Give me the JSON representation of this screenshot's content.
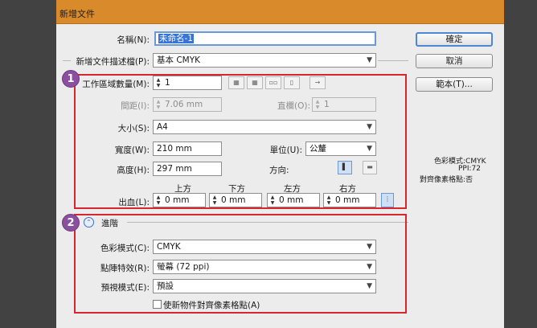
{
  "window": {
    "title": "新增文件"
  },
  "buttons": {
    "ok": "確定",
    "cancel": "取消",
    "templates": "範本(T)..."
  },
  "name": {
    "label": "名稱(N):",
    "value": "未命名-1"
  },
  "profile": {
    "label": "新增文件描述檔(P):",
    "value": "基本 CMYK"
  },
  "artboards": {
    "count_label": "工作區域數量(M):",
    "count": "1",
    "spacing_label": "間距(I):",
    "spacing": "7.06 mm",
    "columns_label": "直欄(O):",
    "columns": "1"
  },
  "size": {
    "label": "大小(S):",
    "value": "A4"
  },
  "width": {
    "label": "寬度(W):",
    "value": "210 mm"
  },
  "height": {
    "label": "高度(H):",
    "value": "297 mm"
  },
  "units": {
    "label": "單位(U):",
    "value": "公釐"
  },
  "orientation": {
    "label": "方向:"
  },
  "bleed": {
    "label": "出血(L):",
    "headers": [
      "上方",
      "下方",
      "左方",
      "右方"
    ],
    "values": [
      "0 mm",
      "0 mm",
      "0 mm",
      "0 mm"
    ]
  },
  "advanced": {
    "title": "進階",
    "color_mode_label": "色彩模式(C):",
    "color_mode": "CMYK",
    "raster_label": "點陣特效(R):",
    "raster": "螢幕 (72 ppi)",
    "preview_label": "預視模式(E):",
    "preview": "預設",
    "align_label": "使新物件對齊像素格點(A)"
  },
  "summary": {
    "color_mode": "色彩模式:CMYK",
    "ppi": "PPI:72",
    "align": "對齊像素格點:否"
  },
  "badges": [
    "1",
    "2"
  ],
  "colors": {
    "highlight_box": "#d7262e",
    "badge": "#8a4f9e",
    "titlebar": "#d98a2b"
  }
}
